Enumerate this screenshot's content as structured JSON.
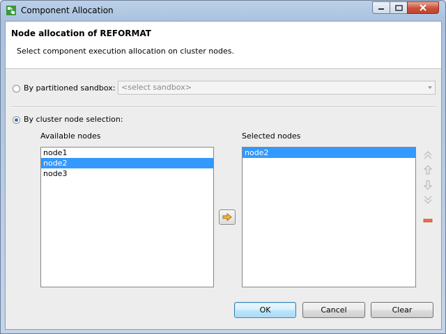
{
  "window": {
    "title": "Component Allocation"
  },
  "header": {
    "heading": "Node allocation of REFORMAT",
    "description": "Select component execution allocation on cluster nodes."
  },
  "partitioned": {
    "label": "By partitioned sandbox:",
    "checked": false,
    "combo_placeholder": "<select sandbox>"
  },
  "cluster": {
    "label": "By cluster node selection:",
    "checked": true
  },
  "available": {
    "label": "Available nodes",
    "items": [
      "node1",
      "node2",
      "node3"
    ],
    "selected_index": 1
  },
  "selected": {
    "label": "Selected nodes",
    "items": [
      "node2"
    ],
    "selected_index": 0
  },
  "buttons": {
    "ok": "OK",
    "cancel": "Cancel",
    "clear": "Clear"
  },
  "colors": {
    "selection": "#3399ff",
    "accent_arrow": "#f2b53a",
    "remove": "#e8704a"
  }
}
